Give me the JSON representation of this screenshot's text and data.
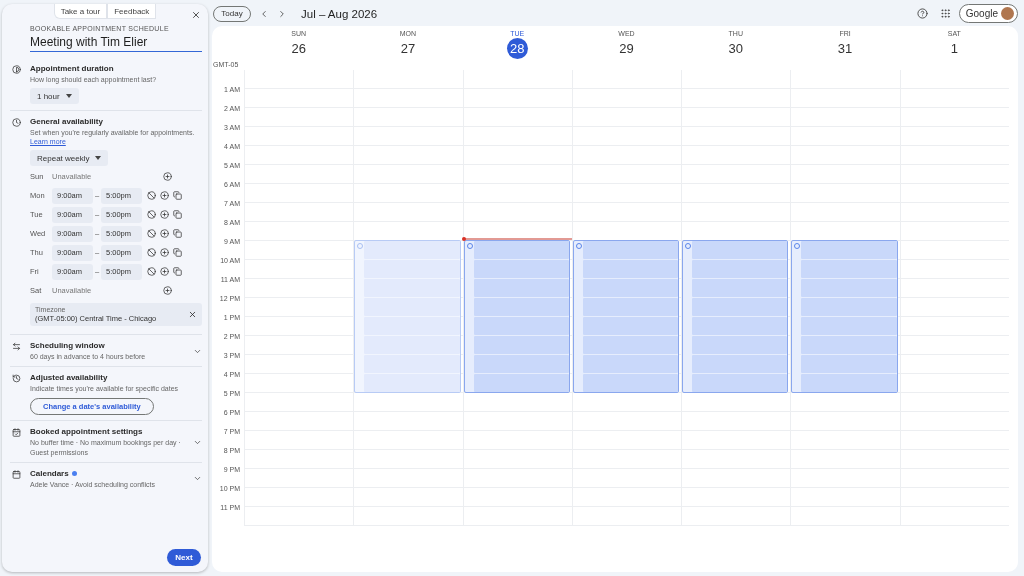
{
  "panel": {
    "top_buttons": [
      "Take a tour",
      "Feedback"
    ],
    "eyebrow": "BOOKABLE APPOINTMENT SCHEDULE",
    "title": "Meeting with Tim Elier",
    "duration": {
      "title": "Appointment duration",
      "subtitle": "How long should each appointment last?",
      "value": "1 hour"
    },
    "availability": {
      "title": "General availability",
      "subtitle": "Set when you're regularly available for appointments.",
      "link": "Learn more",
      "repeat": "Repeat weekly",
      "days": [
        {
          "day": "Sun",
          "available": false,
          "status": "Unavailable"
        },
        {
          "day": "Mon",
          "available": true,
          "start": "9:00am",
          "dash": "–",
          "end": "5:00pm"
        },
        {
          "day": "Tue",
          "available": true,
          "start": "9:00am",
          "dash": "–",
          "end": "5:00pm"
        },
        {
          "day": "Wed",
          "available": true,
          "start": "9:00am",
          "dash": "–",
          "end": "5:00pm"
        },
        {
          "day": "Thu",
          "available": true,
          "start": "9:00am",
          "dash": "–",
          "end": "5:00pm"
        },
        {
          "day": "Fri",
          "available": true,
          "start": "9:00am",
          "dash": "–",
          "end": "5:00pm"
        },
        {
          "day": "Sat",
          "available": false,
          "status": "Unavailable"
        }
      ],
      "timezone": {
        "label": "Timezone",
        "value": "(GMT-05:00) Central Time - Chicago"
      }
    },
    "scheduling_window": {
      "title": "Scheduling window",
      "subtitle": "60 days in advance to 4 hours before",
      "expanded": false
    },
    "adjusted": {
      "title": "Adjusted availability",
      "subtitle": "Indicate times you're available for specific dates",
      "button": "Change a date's availability"
    },
    "booked": {
      "title": "Booked appointment settings",
      "subtitle": "No buffer time · No maximum bookings per day · Guest permissions",
      "expanded": false
    },
    "calendars": {
      "title": "Calendars",
      "subtitle": "Adele Vance · Avoid scheduling conflicts",
      "expanded": false
    },
    "next": "Next"
  },
  "toolbar": {
    "today": "Today",
    "range": "Jul – Aug 2026",
    "account": "Google"
  },
  "calendar": {
    "timezone": "GMT-05",
    "days": [
      {
        "name": "SUN",
        "date": "26",
        "today": false,
        "available": false,
        "now": false
      },
      {
        "name": "MON",
        "date": "27",
        "today": false,
        "available": true,
        "past": true,
        "now": false
      },
      {
        "name": "TUE",
        "date": "28",
        "today": true,
        "available": true,
        "past": false,
        "now": true
      },
      {
        "name": "WED",
        "date": "29",
        "today": false,
        "available": true,
        "past": false,
        "now": false
      },
      {
        "name": "THU",
        "date": "30",
        "today": false,
        "available": true,
        "past": false,
        "now": false
      },
      {
        "name": "FRI",
        "date": "31",
        "today": false,
        "available": true,
        "past": false,
        "now": false
      },
      {
        "name": "SAT",
        "date": "1",
        "today": false,
        "available": false,
        "now": false
      }
    ],
    "hours": [
      "1 AM",
      "2 AM",
      "3 AM",
      "4 AM",
      "5 AM",
      "6 AM",
      "7 AM",
      "8 AM",
      "9 AM",
      "10 AM",
      "11 AM",
      "12 PM",
      "1 PM",
      "2 PM",
      "3 PM",
      "4 PM",
      "5 PM",
      "6 PM",
      "7 PM",
      "8 PM",
      "9 PM",
      "10 PM",
      "11 PM"
    ]
  }
}
